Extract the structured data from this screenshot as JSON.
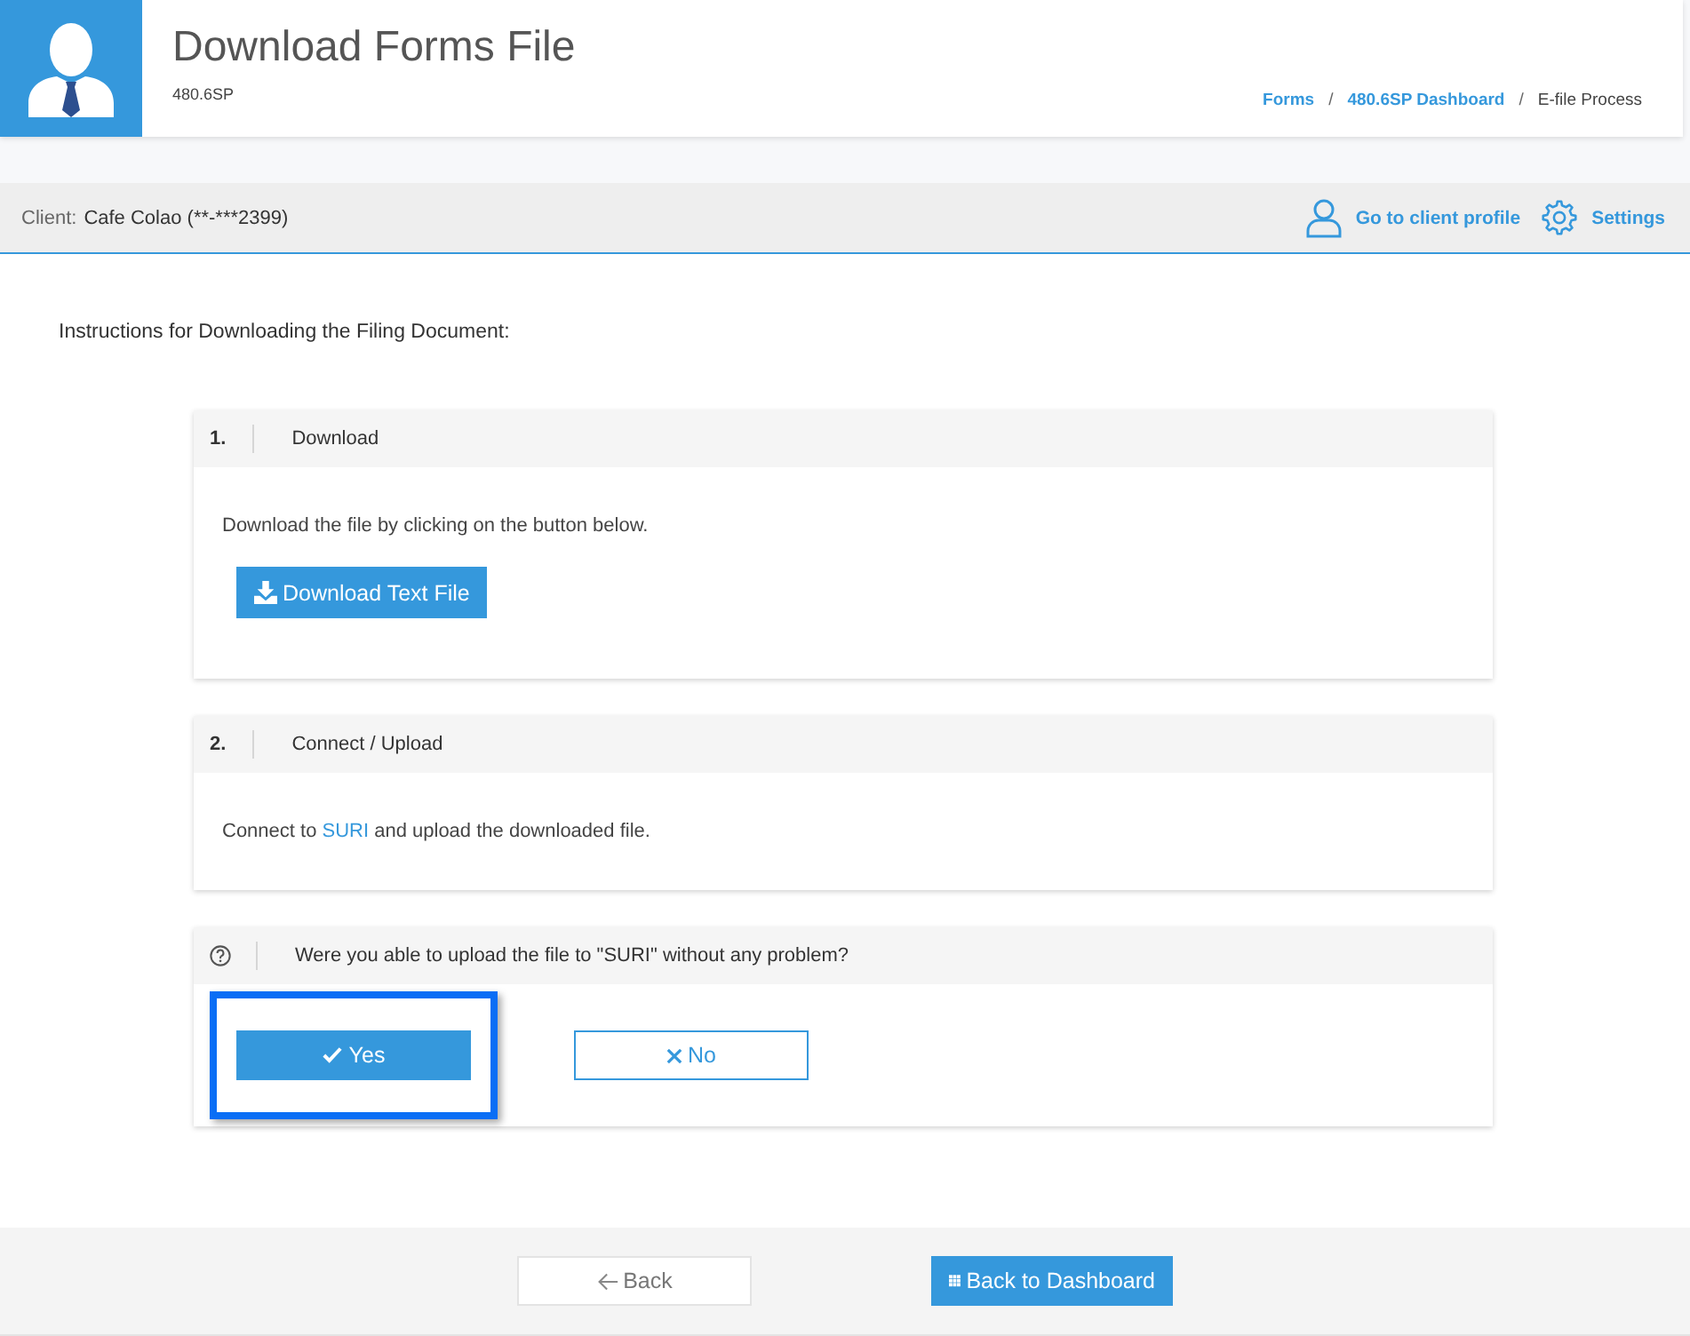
{
  "header": {
    "title": "Download Forms File",
    "subtitle": "480.6SP",
    "breadcrumb": [
      {
        "label": "Forms",
        "kind": "link"
      },
      {
        "label": "/",
        "kind": "separator"
      },
      {
        "label": "480.6SP Dashboard",
        "kind": "link"
      },
      {
        "label": "/",
        "kind": "separator"
      },
      {
        "label": "E-file Process",
        "kind": "current"
      }
    ]
  },
  "client_bar": {
    "label": "Client:",
    "name": "Cafe Colao (**-***2399)",
    "actions": [
      {
        "label": "Go to client profile",
        "kind": "profile"
      },
      {
        "label": "Settings",
        "kind": "settings"
      }
    ]
  },
  "instructions_heading": "Instructions for Downloading the Filing Document:",
  "cards": [
    {
      "kind": "step",
      "number": "1.",
      "title": "Download",
      "text": [
        {
          "text": "Download the file by clicking on the button below."
        }
      ],
      "buttons": [
        {
          "label": "Download Text File",
          "kind": "download",
          "highlighted": false
        }
      ]
    },
    {
      "kind": "step",
      "number": "2.",
      "title": "Connect / Upload",
      "text": [
        {
          "text": "Connect to "
        },
        {
          "text": "SURI",
          "kind": "link"
        },
        {
          "text": " and upload the downloaded file."
        }
      ]
    },
    {
      "kind": "question",
      "title": "Were you able to upload the file to \"SURI\" without any problem?",
      "buttons": [
        {
          "label": "Yes",
          "kind": "confirm",
          "highlighted": true
        },
        {
          "label": "No",
          "kind": "decline",
          "highlighted": false
        }
      ]
    }
  ],
  "footer": {
    "buttons": [
      {
        "label": "Back",
        "kind": "back"
      },
      {
        "label": "Back to Dashboard",
        "kind": "dashboard"
      }
    ]
  }
}
